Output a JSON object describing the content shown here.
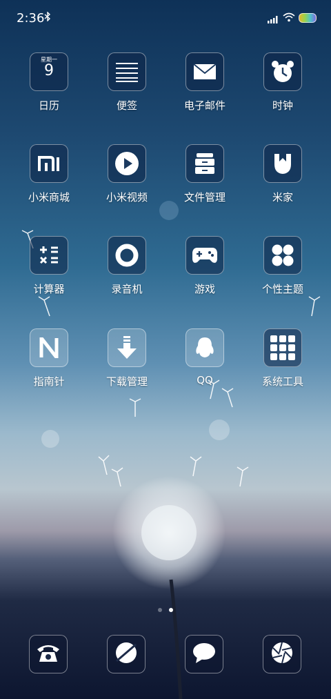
{
  "status_bar": {
    "time": "2:36"
  },
  "apps": [
    {
      "label": "日历",
      "weekday": "星期一",
      "day": "9"
    },
    {
      "label": "便签"
    },
    {
      "label": "电子邮件"
    },
    {
      "label": "时钟"
    },
    {
      "label": "小米商城",
      "mark": "mi"
    },
    {
      "label": "小米视频"
    },
    {
      "label": "文件管理"
    },
    {
      "label": "米家"
    },
    {
      "label": "计算器"
    },
    {
      "label": "录音机"
    },
    {
      "label": "游戏"
    },
    {
      "label": "个性主题"
    },
    {
      "label": "指南针",
      "mark": "N"
    },
    {
      "label": "下载管理"
    },
    {
      "label": "QQ"
    },
    {
      "label": "系统工具"
    }
  ],
  "dock": [
    {
      "icon": "phone-icon"
    },
    {
      "icon": "browser-icon"
    },
    {
      "icon": "messages-icon"
    },
    {
      "icon": "camera-icon"
    }
  ],
  "page_indicator": {
    "pages": 2,
    "current": 2
  }
}
